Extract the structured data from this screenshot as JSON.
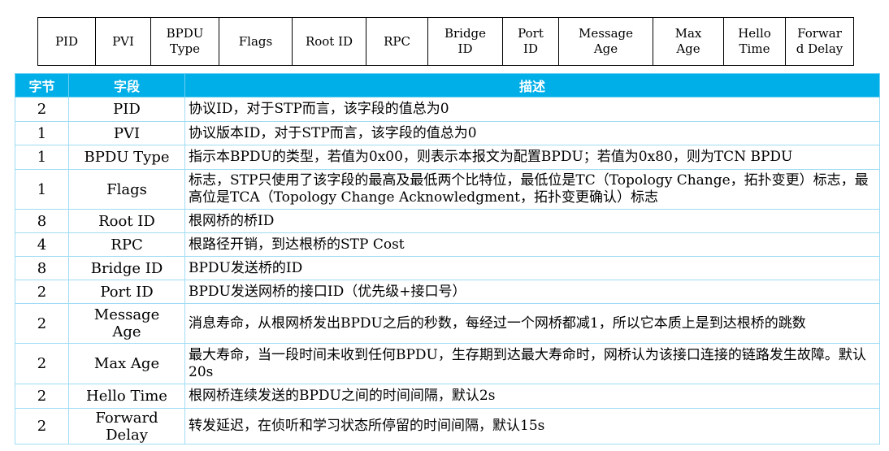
{
  "frame_fields": [
    "PID",
    "PVI",
    "BPDU Type",
    "Flags",
    "Root ID",
    "RPC",
    "Bridge ID",
    "Port ID",
    "Message Age",
    "Max Age",
    "Hello Time",
    "Forward Delay"
  ],
  "frame_labels": [
    "PID",
    "PVI",
    "BPDU\nType",
    "Flags",
    "Root ID",
    "RPC",
    "Bridge\nID",
    "Port\nID",
    "Message\nAge",
    "Max\nAge",
    "Hello\nTime",
    "Forwar\nd Delay"
  ],
  "table": {
    "headers": {
      "byte": "字节",
      "field": "字段",
      "desc": "描述"
    },
    "rows": [
      {
        "byte": "2",
        "field": "PID",
        "desc": "协议ID，对于STP而言，该字段的值总为0"
      },
      {
        "byte": "1",
        "field": "PVI",
        "desc": "协议版本ID，对于STP而言，该字段的值总为0"
      },
      {
        "byte": "1",
        "field": "BPDU Type",
        "desc": "指示本BPDU的类型，若值为0x00，则表示本报文为配置BPDU；若值为0x80，则为TCN BPDU"
      },
      {
        "byte": "1",
        "field": "Flags",
        "desc": "标志，STP只使用了该字段的最高及最低两个比特位，最低位是TC（Topology Change，拓扑变更）标志，最高位是TCA（Topology Change Acknowledgment，拓扑变更确认）标志"
      },
      {
        "byte": "8",
        "field": "Root ID",
        "desc": "根网桥的桥ID"
      },
      {
        "byte": "4",
        "field": "RPC",
        "desc": "根路径开销，到达根桥的STP Cost"
      },
      {
        "byte": "8",
        "field": "Bridge ID",
        "desc": "BPDU发送桥的ID"
      },
      {
        "byte": "2",
        "field": "Port ID",
        "desc": "BPDU发送网桥的接口ID（优先级+接口号）"
      },
      {
        "byte": "2",
        "field": "Message Age",
        "desc": "消息寿命，从根网桥发出BPDU之后的秒数，每经过一个网桥都减1，所以它本质上是到达根桥的跳数"
      },
      {
        "byte": "2",
        "field": "Max Age",
        "desc": "最大寿命，当一段时间未收到任何BPDU，生存期到达最大寿命时，网桥认为该接口连接的链路发生故障。默认20s"
      },
      {
        "byte": "2",
        "field": "Hello Time",
        "desc": "根网桥连续发送的BPDU之间的时间间隔，默认2s"
      },
      {
        "byte": "2",
        "field": "Forward Delay",
        "desc": "转发延迟，在侦听和学习状态所停留的时间间隔，默认15s"
      }
    ]
  },
  "colors": {
    "header_bg": "#00aee8",
    "header_text": "#ffffff",
    "border": "#9fdcf4"
  }
}
